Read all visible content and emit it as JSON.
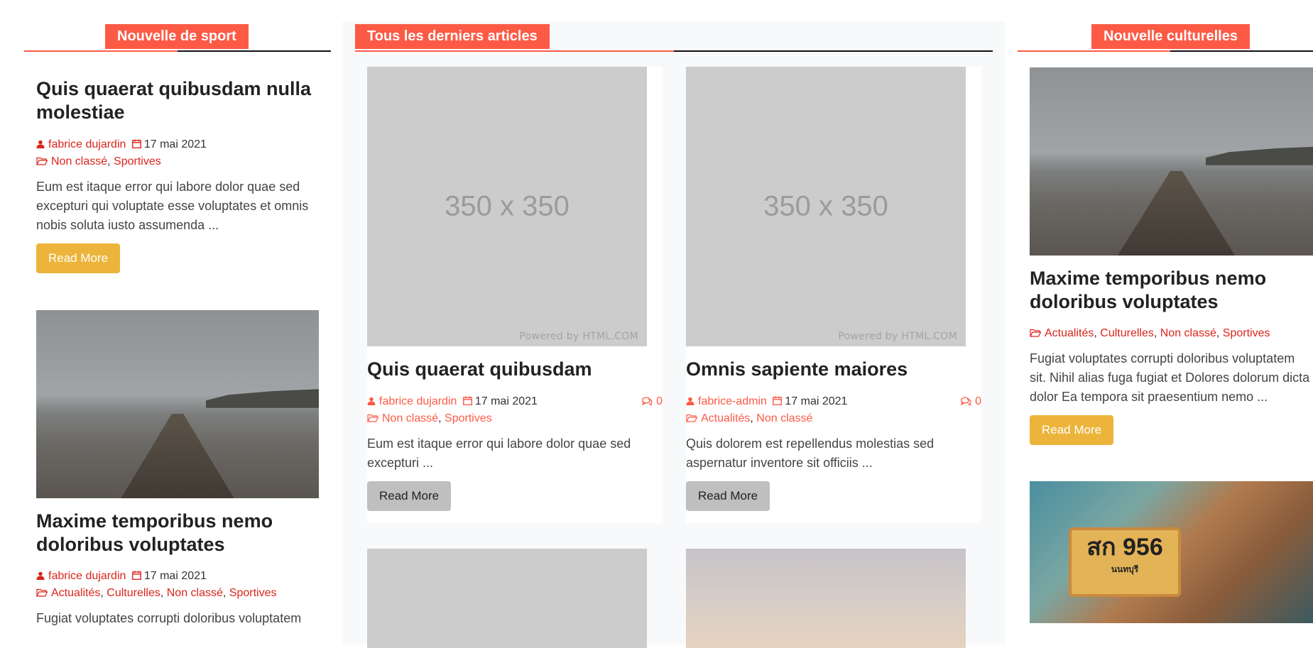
{
  "left": {
    "section_title": "Nouvelle de sport",
    "posts": [
      {
        "title": "Quis quaerat quibusdam nulla molestiae",
        "author": "fabrice dujardin",
        "date": "17 mai 2021",
        "categories": [
          "Non classé",
          "Sportives"
        ],
        "excerpt": "Eum est itaque error qui labore dolor quae sed excepturi qui voluptate esse voluptates et omnis nobis soluta iusto assumenda ...",
        "button": "Read More"
      },
      {
        "title": "Maxime temporibus nemo doloribus voluptates",
        "author": "fabrice dujardin",
        "date": "17 mai 2021",
        "categories": [
          "Actualités",
          "Culturelles",
          "Non classé",
          "Sportives"
        ],
        "excerpt": "Fugiat voluptates corrupti doloribus voluptatem"
      }
    ]
  },
  "middle": {
    "section_title": "Tous les derniers articles",
    "placeholder": {
      "dimensions": "350 x 350",
      "powered": "Powered by HTML.COM"
    },
    "posts": [
      {
        "title": "Quis quaerat quibusdam",
        "author": "fabrice dujardin",
        "date": "17 mai 2021",
        "comments": "0",
        "categories": [
          "Non classé",
          "Sportives"
        ],
        "excerpt": "Eum est itaque error qui labore dolor quae sed excepturi ...",
        "button": "Read More"
      },
      {
        "title": "Omnis sapiente maiores",
        "author": "fabrice-admin",
        "date": "17 mai 2021",
        "comments": "0",
        "categories": [
          "Actualités",
          "Non classé"
        ],
        "excerpt": "Quis dolorem est repellendus molestias sed aspernatur inventore sit officiis ...",
        "button": "Read More"
      }
    ]
  },
  "right": {
    "section_title": "Nouvelle culturelles",
    "posts": [
      {
        "title": "Maxime temporibus nemo doloribus voluptates",
        "categories": [
          "Actualités",
          "Culturelles",
          "Non classé",
          "Sportives"
        ],
        "excerpt": "Fugiat voluptates corrupti doloribus voluptatem sit. Nihil alias fuga fugiat et Dolores dolorum dicta dolor Ea tempora sit praesentium nemo ...",
        "button": "Read More"
      },
      {
        "plate_text": "สก 956",
        "plate_sub": "นนทบุรี"
      }
    ]
  },
  "colors": {
    "accent": "#fd5a45",
    "link": "#d9251c",
    "button_yellow": "#ecb43a",
    "button_grey": "#bfbfbf"
  }
}
